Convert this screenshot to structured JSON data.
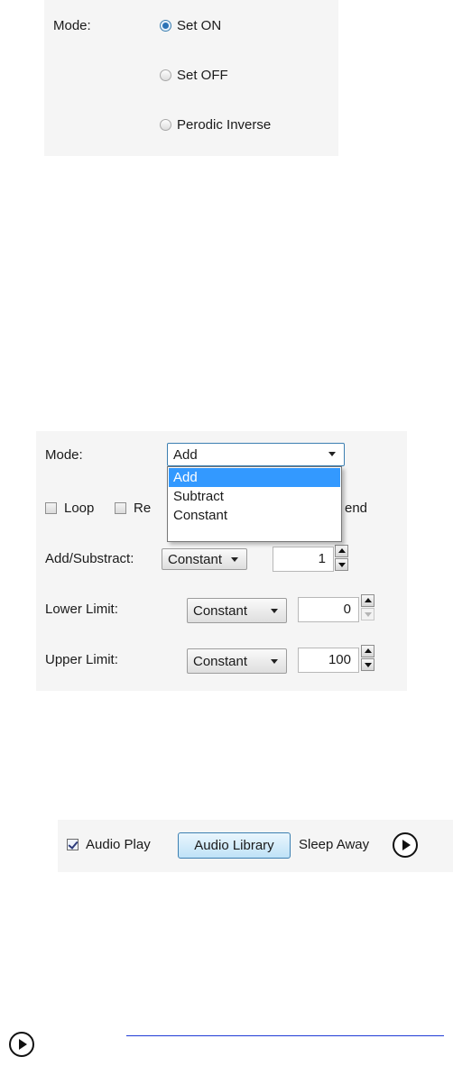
{
  "mode_radio_panel": {
    "mode_label": "Mode:",
    "options": [
      {
        "label": "Set ON",
        "checked": true
      },
      {
        "label": "Set OFF",
        "checked": false
      },
      {
        "label": "Perodic Inverse",
        "checked": false
      }
    ]
  },
  "settings_panel": {
    "mode_label": "Mode:",
    "mode_value": "Add",
    "dropdown_open": true,
    "dropdown_options": [
      "Add",
      "Subtract",
      "Constant"
    ],
    "dropdown_selected": "Add",
    "loop_label": "Loop",
    "loop_checked": false,
    "partial_checkbox_label": "Re",
    "partial_trailing_text": "end",
    "rows": [
      {
        "label": "Add/Substract:",
        "source": "Constant",
        "value": "1"
      },
      {
        "label": "Lower Limit:",
        "source": "Constant",
        "value": "0"
      },
      {
        "label": "Upper Limit:",
        "source": "Constant",
        "value": "100"
      }
    ]
  },
  "audio_panel": {
    "audio_play_label": "Audio Play",
    "audio_play_checked": true,
    "audio_library_button": "Audio Library",
    "track_name": "Sleep Away",
    "play_icon": "play-circle-icon"
  },
  "bottom": {
    "play_icon": "play-circle-icon"
  },
  "colors": {
    "panel_bg": "#f5f5f5",
    "accent": "#3399ff",
    "focus_border": "#3c7fb1",
    "link_line": "#1f3bd6"
  }
}
